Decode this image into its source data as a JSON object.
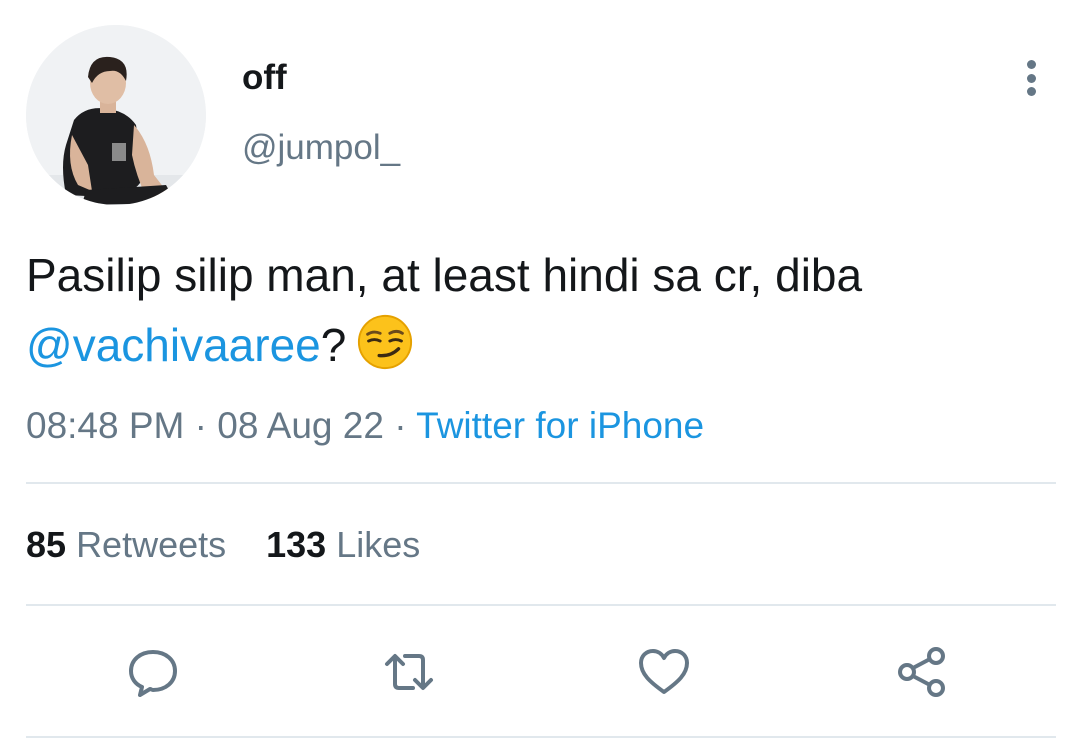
{
  "user": {
    "display_name": "off",
    "handle": "@jumpol_"
  },
  "tweet": {
    "text_before": "Pasilip silip man, at least hindi sa cr, diba ",
    "mention": "@vachivaaree",
    "text_after": "?",
    "emoji": "smirking-face"
  },
  "meta": {
    "time": "08:48 PM",
    "separator": " · ",
    "date": "08 Aug 22",
    "source": "Twitter for iPhone"
  },
  "stats": {
    "retweets_count": "85",
    "retweets_label": "Retweets",
    "likes_count": "133",
    "likes_label": "Likes"
  },
  "actions": {
    "icons": [
      "reply-icon",
      "retweet-icon",
      "like-icon",
      "share-icon"
    ]
  },
  "colors": {
    "link": "#1b95e0",
    "secondary_text": "#657786",
    "primary_text": "#14171a",
    "divider": "#e1e8ed"
  }
}
